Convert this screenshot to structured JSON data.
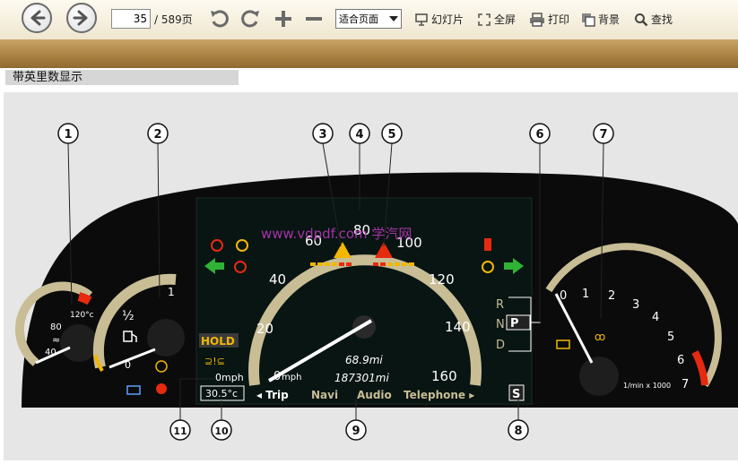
{
  "toolbar": {
    "page_current": "35",
    "page_total": "/ 589页",
    "zoom_value": "适合页面",
    "slideshow_label": "幻灯片",
    "fullscreen_label": "全屏",
    "print_label": "打印",
    "background_label": "背景",
    "find_label": "查找"
  },
  "document": {
    "section_title": "带英里数显示"
  },
  "figure": {
    "callouts": [
      "1",
      "2",
      "3",
      "4",
      "5",
      "6",
      "7",
      "8",
      "9",
      "10",
      "11"
    ],
    "watermark": "www.vdpdf.com  学汽网",
    "coolant_labels": [
      "120°c",
      "80",
      "40"
    ],
    "fuel_labels": [
      "1",
      "½",
      "0"
    ],
    "speed_labels": [
      "20",
      "40",
      "60",
      "80",
      "100",
      "120",
      "140",
      "160",
      "0"
    ],
    "speed_unit": "mph",
    "hold_label": "HOLD",
    "mph_readout": "0mph",
    "temp_readout": "30.5°c",
    "trip_distance": "68.9mi",
    "total_distance": "187301mi",
    "menu_items": [
      "◂ Trip",
      "Navi",
      "Audio",
      "Telephone ▸"
    ],
    "gear_labels": [
      "R",
      "P",
      "N",
      "D"
    ],
    "rpm_labels": [
      "0",
      "1",
      "2",
      "3",
      "4",
      "5",
      "6",
      "7"
    ],
    "rpm_unit": "1/min x 1000",
    "s_label": "S",
    "colors": {
      "cluster": "#111111",
      "bezel": "#c8bd95",
      "warning_red": "#e62a10",
      "warning_yellow": "#f2b705",
      "green_arrow": "#2fb236"
    }
  }
}
